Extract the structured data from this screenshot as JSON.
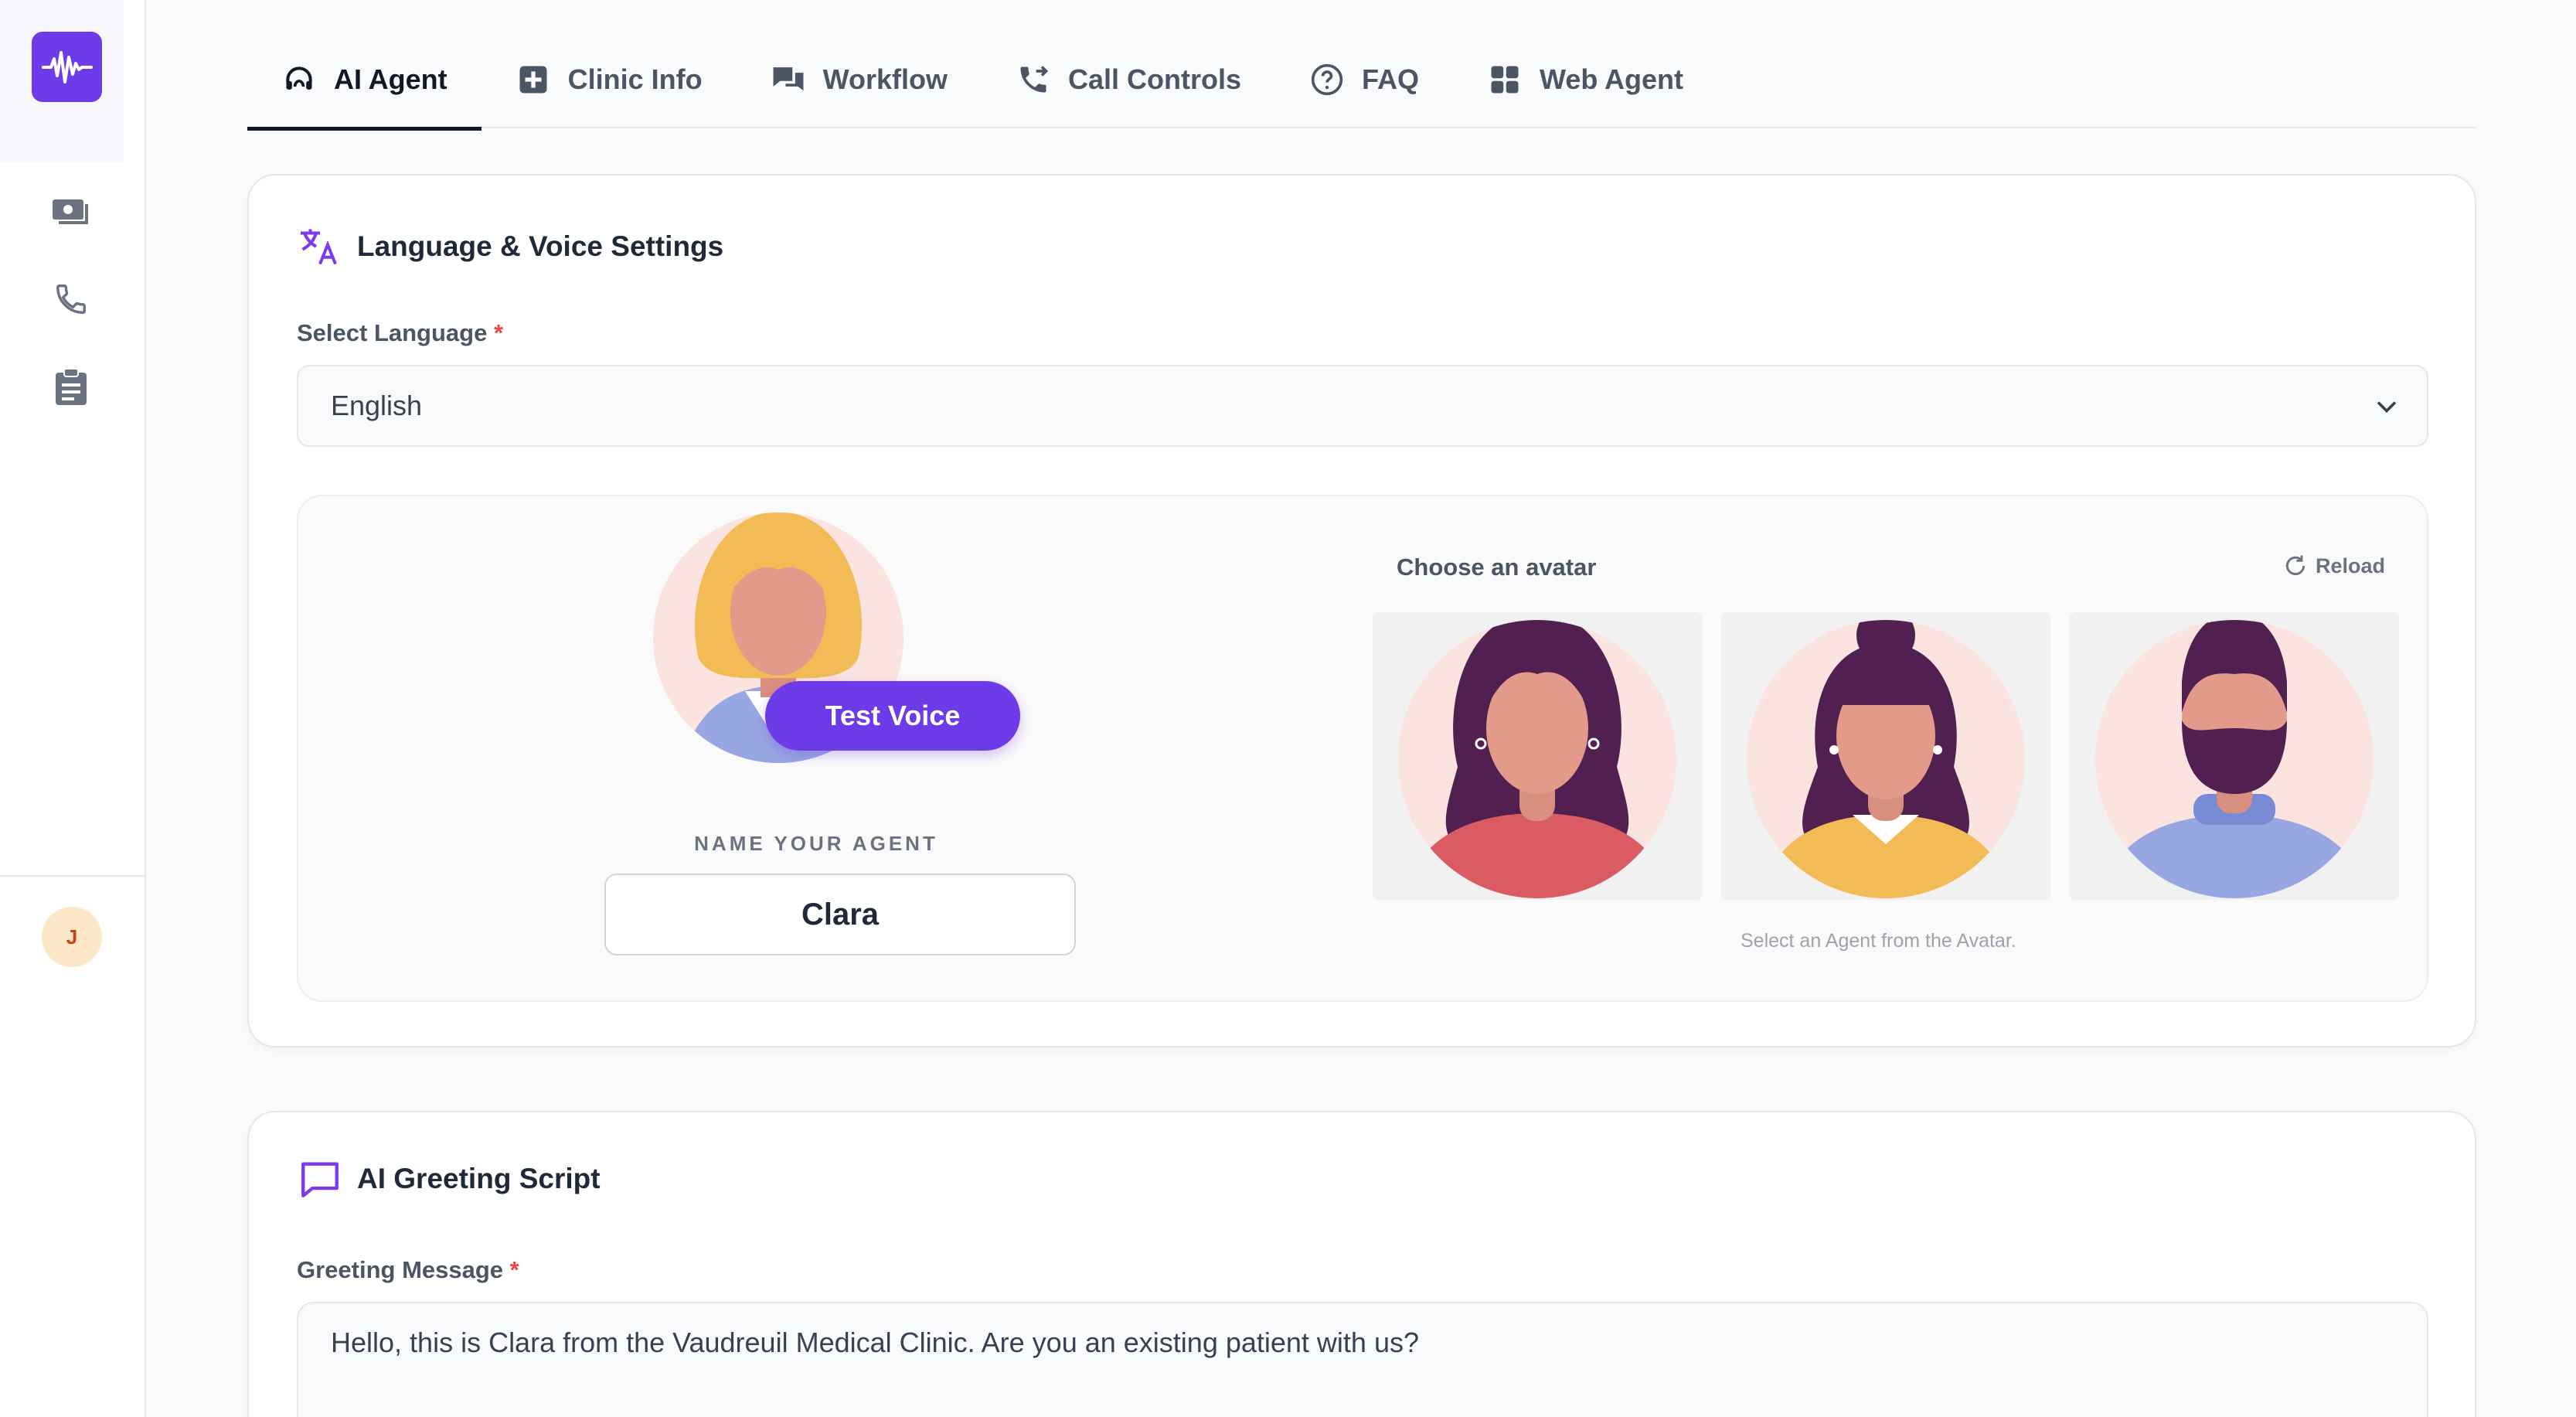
{
  "sidebar": {
    "items": [
      {
        "icon": "money-icon"
      },
      {
        "icon": "phone-icon"
      },
      {
        "icon": "clipboard-icon"
      }
    ],
    "user_initial": "J"
  },
  "tabs": [
    {
      "label": "AI Agent",
      "icon": "headset-icon",
      "active": true
    },
    {
      "label": "Clinic Info",
      "icon": "medical-plus-icon",
      "active": false
    },
    {
      "label": "Workflow",
      "icon": "chat-bubbles-icon",
      "active": false
    },
    {
      "label": "Call Controls",
      "icon": "phone-forward-icon",
      "active": false
    },
    {
      "label": "FAQ",
      "icon": "question-icon",
      "active": false
    },
    {
      "label": "Web Agent",
      "icon": "grid-icon",
      "active": false
    }
  ],
  "language_card": {
    "title": "Language & Voice Settings",
    "language_label": "Select Language",
    "required_mark": "*",
    "language_value": "English",
    "test_voice_label": "Test Voice",
    "name_label": "NAME YOUR AGENT",
    "agent_name": "Clara",
    "choose_avatar_label": "Choose an avatar",
    "reload_label": "Reload",
    "avatar_hint": "Select an Agent from the Avatar."
  },
  "greeting_card": {
    "title": "AI Greeting Script",
    "greeting_label": "Greeting Message",
    "required_mark": "*",
    "greeting_value": "Hello, this is Clara from the Vaudreuil Medical Clinic. Are you an existing patient with us?"
  },
  "colors": {
    "accent": "#6d3be8",
    "required": "#ef4444"
  }
}
